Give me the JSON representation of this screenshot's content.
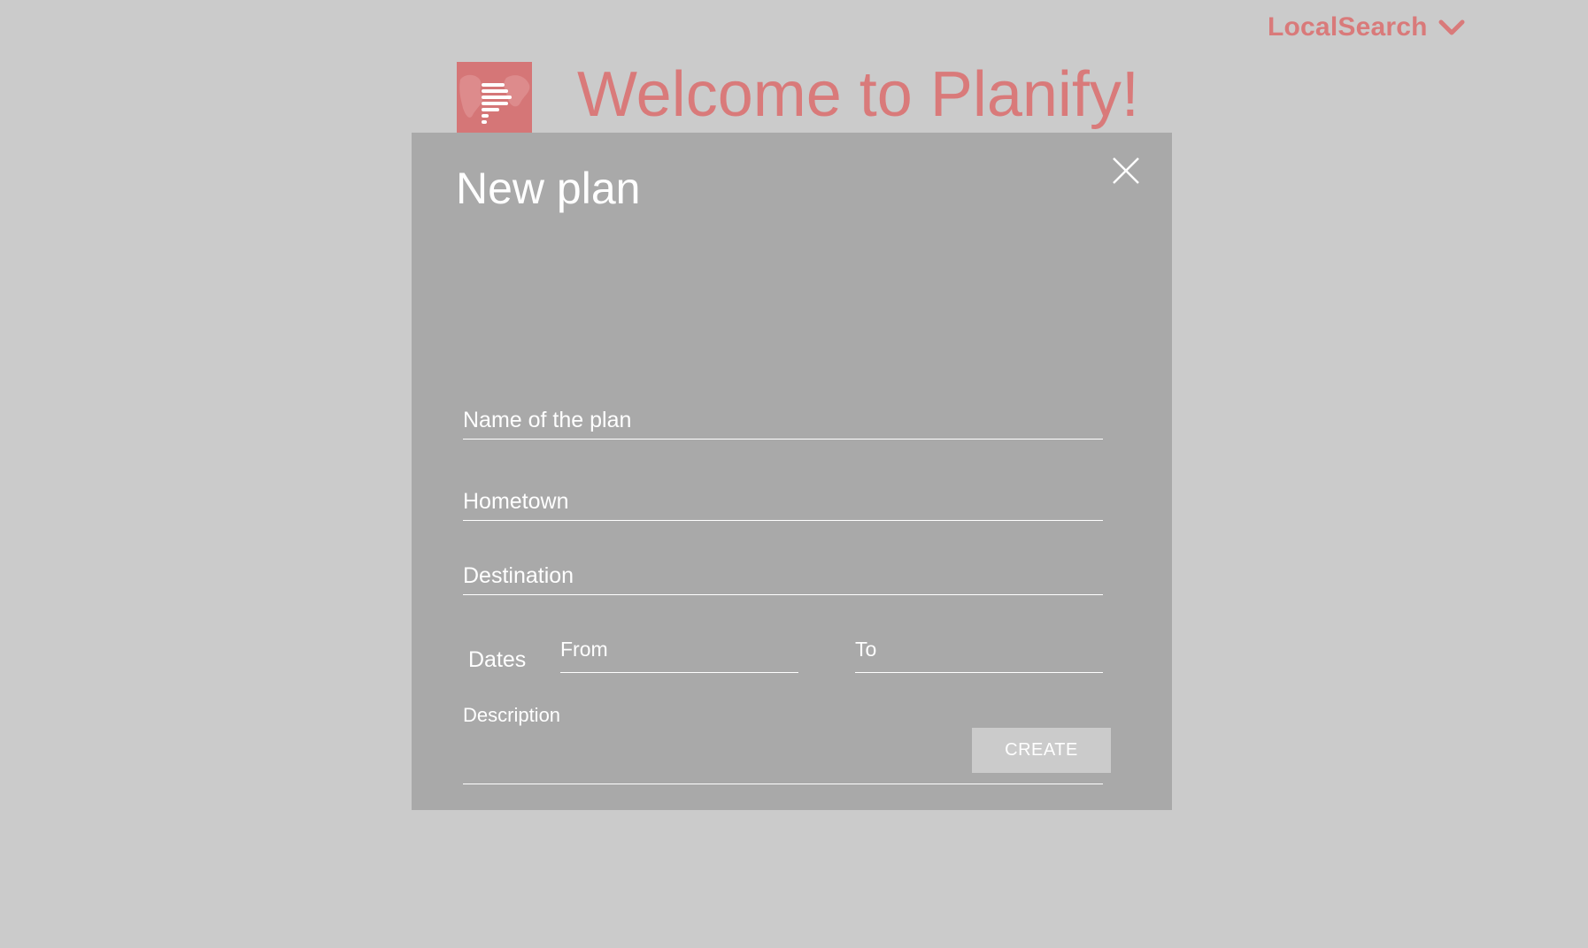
{
  "header": {
    "account_label": "LocalSearch",
    "welcome_title": "Welcome to Planify!"
  },
  "logo": {
    "icon": "map-list-logo"
  },
  "modal": {
    "title": "New plan",
    "fields": {
      "name_placeholder": "Name of the plan",
      "hometown_placeholder": "Hometown",
      "destination_placeholder": "Destination",
      "dates_label": "Dates",
      "from_placeholder": "From",
      "to_placeholder": "To",
      "description_label": "Description"
    },
    "create_label": "CREATE"
  },
  "colors": {
    "background": "#cbcbcb",
    "modal": "#a9a9a9",
    "accent": "#d97a7a",
    "text_on_modal": "#ffffff"
  }
}
